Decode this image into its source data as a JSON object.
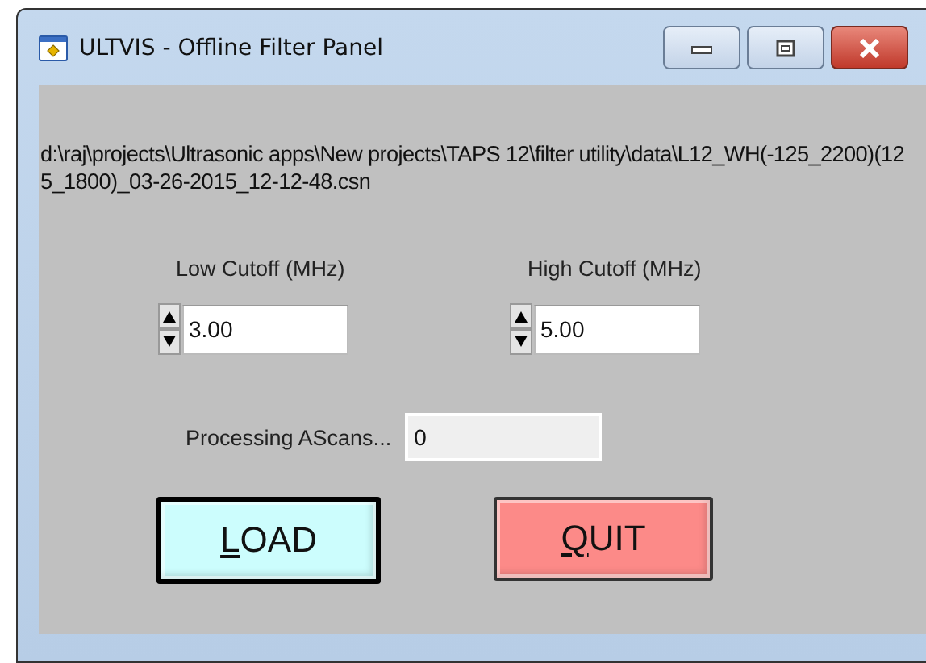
{
  "window": {
    "title": "ULTVIS - Offline Filter Panel"
  },
  "file_path": "d:\\raj\\projects\\Ultrasonic apps\\New projects\\TAPS 12\\filter utility\\data\\L12_WH(-125_2200)(125_1800)_03-26-2015_12-12-48.csn",
  "cutoffs": [
    {
      "label": "Low Cutoff (MHz)",
      "value": "3.00"
    },
    {
      "label": "High Cutoff (MHz)",
      "value": "5.00"
    }
  ],
  "progress": {
    "label": "Processing AScans...",
    "value": "0"
  },
  "buttons": [
    {
      "kind": "load",
      "mnemonic": "L",
      "rest": "OAD"
    },
    {
      "kind": "quit",
      "mnemonic": "Q",
      "rest": "UIT"
    }
  ]
}
